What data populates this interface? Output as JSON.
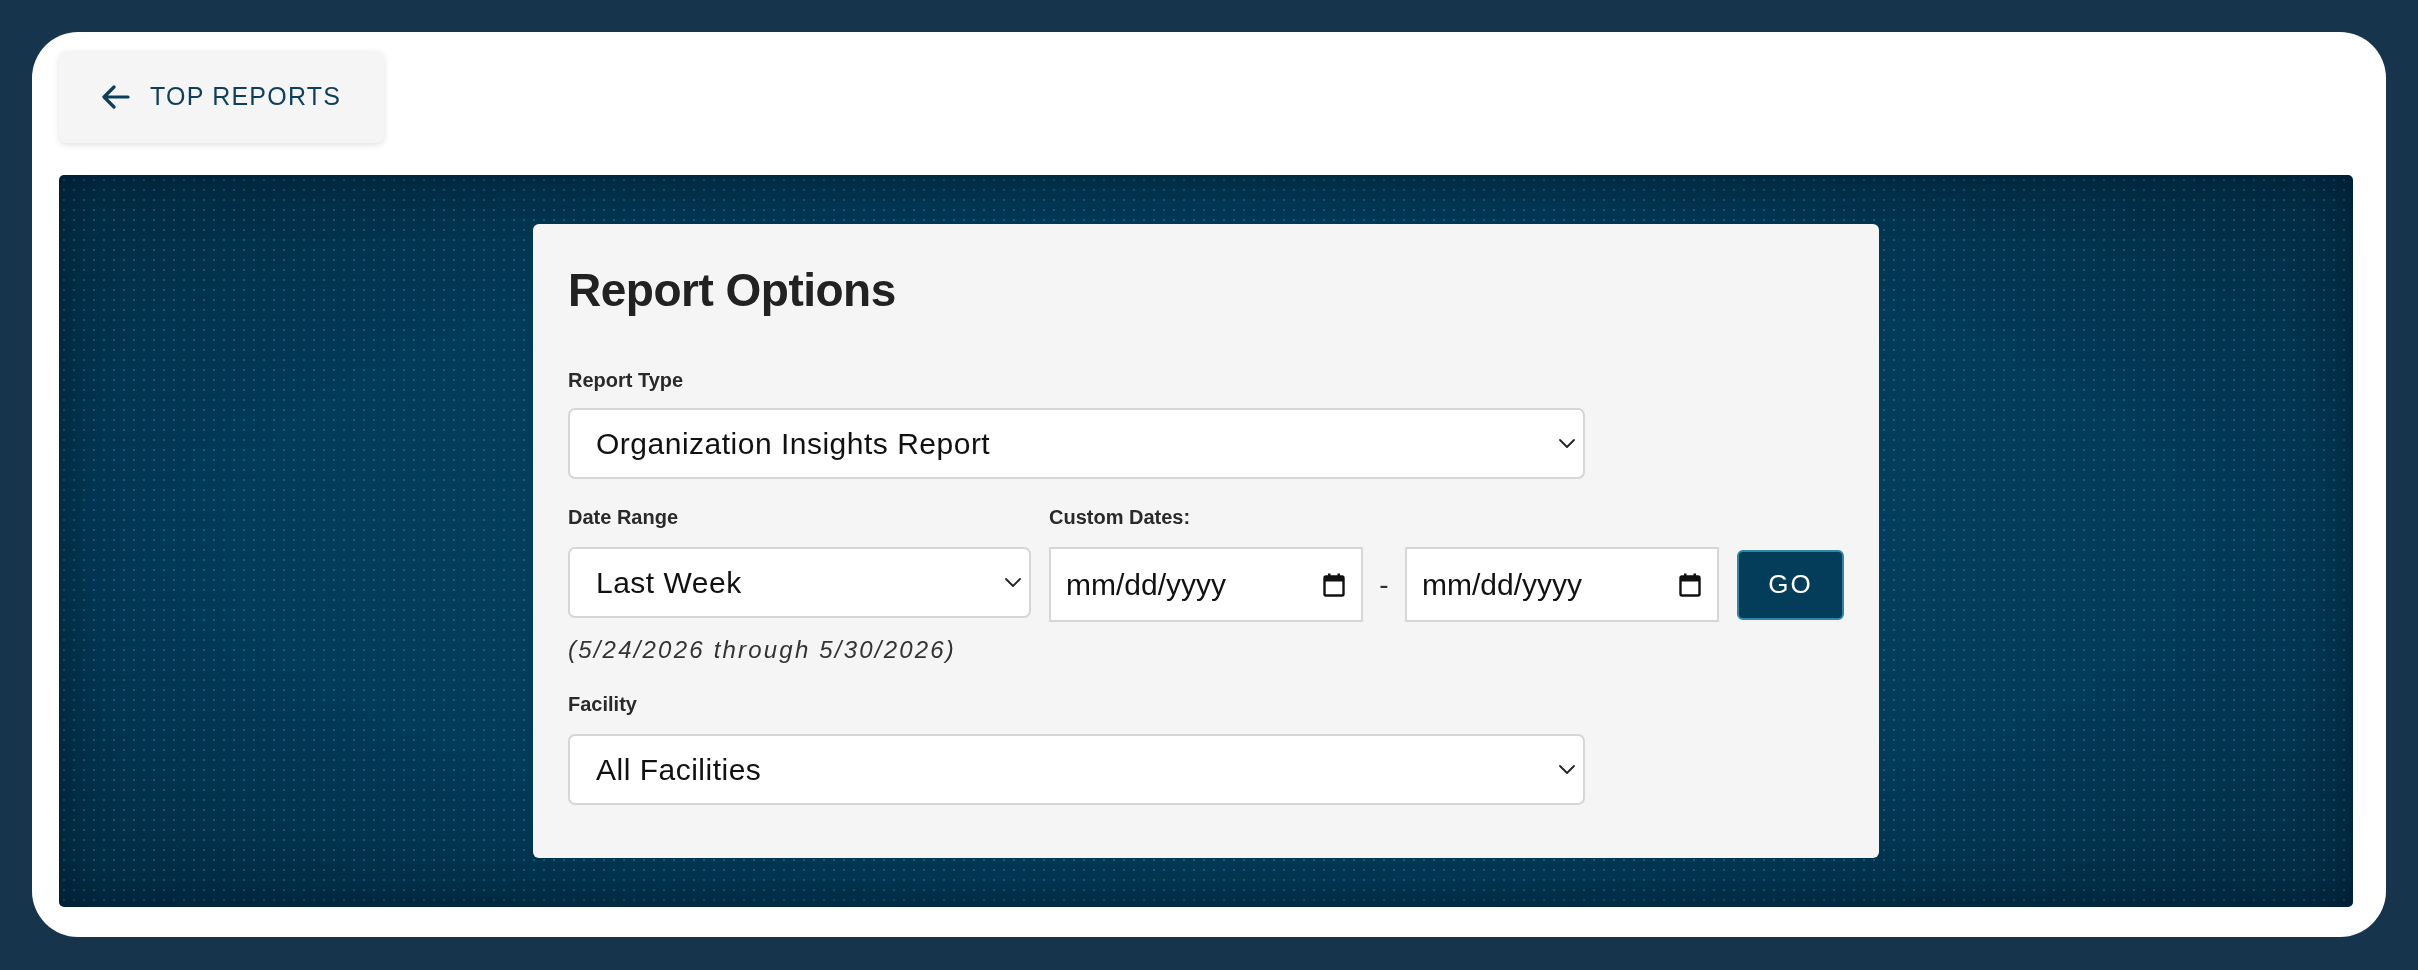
{
  "back_button": {
    "label": "TOP REPORTS"
  },
  "form": {
    "title": "Report Options",
    "report_type": {
      "label": "Report Type",
      "value": "Organization Insights Report"
    },
    "date_range": {
      "label": "Date Range",
      "value": "Last Week",
      "note": "(5/24/2026 through 5/30/2026)"
    },
    "custom_dates": {
      "label": "Custom Dates:",
      "fields": [
        {
          "placeholder": "mm/dd/yyyy"
        },
        {
          "placeholder": "mm/dd/yyyy"
        }
      ],
      "separator": "-",
      "button": "GO"
    },
    "facility": {
      "label": "Facility",
      "value": "All Facilities"
    }
  }
}
